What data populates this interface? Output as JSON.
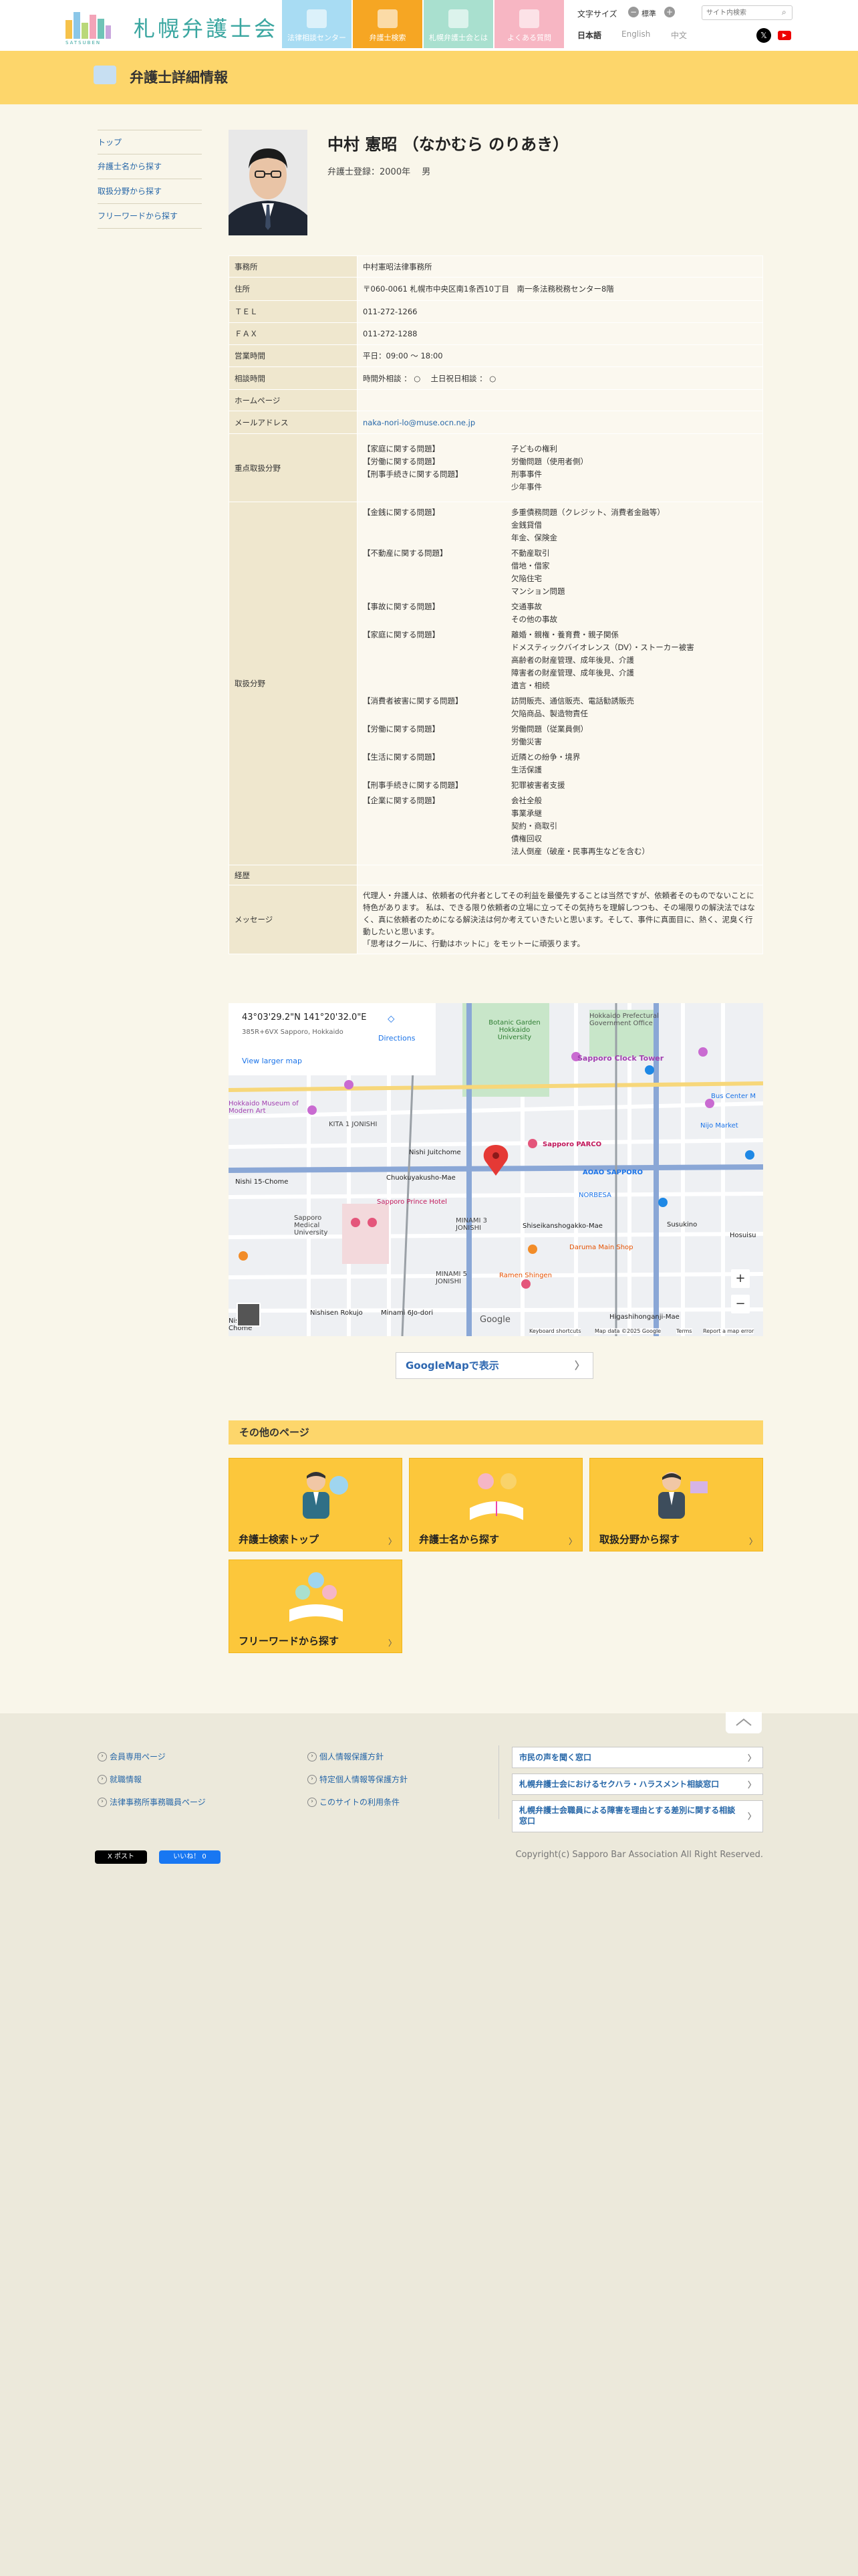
{
  "header": {
    "logo_text": "札幌弁護士会",
    "logo_sub": "SATSUBEN",
    "nav": [
      {
        "label": "法律相談センター",
        "color": "#a8dcf3"
      },
      {
        "label": "弁護士検索",
        "color": "#f6a623"
      },
      {
        "label": "札幌弁護士会とは",
        "color": "#a9e0cf"
      },
      {
        "label": "よくある質問",
        "color": "#f7b6c3"
      }
    ],
    "font_size_label": "文字サイズ",
    "font_size_value": "標準",
    "search_placeholder": "サイト内検索",
    "langs": [
      "日本語",
      "English",
      "中文"
    ]
  },
  "band": {
    "title": "弁護士詳細情報"
  },
  "sidebar": {
    "items": [
      "トップ",
      "弁護士名から探す",
      "取扱分野から探す",
      "フリーワードから探す"
    ]
  },
  "lawyer": {
    "name": "中村 憲昭 （なかむら のりあき）",
    "registration": "弁護士登録：2000年　 男"
  },
  "info": {
    "office_label": "事務所",
    "office": "中村憲昭法律事務所",
    "address_label": "住所",
    "address": "〒060-0061 札幌市中央区南1条西10丁目　南一条法務税務センター8階",
    "tel_label": "ＴＥＬ",
    "tel": "011-272-1266",
    "fax_label": "ＦＡＸ",
    "fax": "011-272-1288",
    "hours_label": "営業時間",
    "hours": "平日：09:00 ～ 18:00",
    "consult_label": "相談時間",
    "consult": "時間外相談 ： ○ 　土日祝日相談 ： ○",
    "homepage_label": "ホームページ",
    "homepage": "",
    "email_label": "メールアドレス",
    "email": "naka-nori-lo@muse.ocn.ne.jp",
    "focus_label": "重点取扱分野",
    "focus": [
      {
        "k": "【家庭に関する問題】",
        "v": [
          "子どもの権利"
        ]
      },
      {
        "k": "【労働に関する問題】",
        "v": [
          "労働問題（使用者側）"
        ]
      },
      {
        "k": "【刑事手続きに関する問題】",
        "v": [
          "刑事事件",
          "少年事件"
        ]
      }
    ],
    "fields_label": "取扱分野",
    "fields": [
      {
        "k": "【金銭に関する問題】",
        "v": [
          "多重債務問題（クレジット、消費者金融等）",
          "金銭貸借",
          "年金、保険金"
        ]
      },
      {
        "k": "【不動産に関する問題】",
        "v": [
          "不動産取引",
          "借地・借家",
          "欠陥住宅",
          "マンション問題"
        ]
      },
      {
        "k": "【事故に関する問題】",
        "v": [
          "交通事故",
          "その他の事故"
        ]
      },
      {
        "k": "【家庭に関する問題】",
        "v": [
          "離婚・親権・養育費・親子関係",
          "ドメスティックバイオレンス（DV）・ストーカー被害",
          "高齢者の財産管理、成年後見、介護",
          "障害者の財産管理、成年後見、介護",
          "遺言・相続"
        ]
      },
      {
        "k": "【消費者被害に関する問題】",
        "v": [
          "訪問販売、通信販売、電話勧誘販売",
          "欠陥商品、製造物責任"
        ]
      },
      {
        "k": "【労働に関する問題】",
        "v": [
          "労働問題（従業員側）",
          "労働災害"
        ]
      },
      {
        "k": "【生活に関する問題】",
        "v": [
          "近隣との紛争・境界",
          "生活保護"
        ]
      },
      {
        "k": "【刑事手続きに関する問題】",
        "v": [
          "犯罪被害者支援"
        ]
      },
      {
        "k": "【企業に関する問題】",
        "v": [
          "会社全般",
          "事業承継",
          "契約・商取引",
          "債権回収",
          "法人倒産（破産・民事再生などを含む）"
        ]
      }
    ],
    "career_label": "経歴",
    "career": "",
    "message_label": "メッセージ",
    "message": "代理人・弁護人は、依頼者の代弁者としてその利益を最優先することは当然ですが、依頼者そのものでないことに特色があります。 私は、できる限り依頼者の立場に立ってその気持ちを理解しつつも、その場限りの解決法ではなく、真に依頼者のためになる解決法は何か考えていきたいと思います。そして、事件に真面目に、熱く、泥臭く行動したいと思います。\n「思考はクールに、行動はホットに」をモットーに頑張ります。"
  },
  "map": {
    "coords": "43°03'29.2\"N 141°20'32.0\"E",
    "plus_code": "385R+6VX Sapporo, Hokkaido",
    "larger": "View larger map",
    "directions": "Directions",
    "labels": [
      "Botanic Garden Hokkaido University",
      "Hokkaido Prefectural Government Office",
      "Sapporo Clock Tower",
      "Hokkaido Museum of Modern Art",
      "KITA 1 JONISHI",
      "Nishi Juitchome",
      "Chuokuyakusho-Mae",
      "Sapporo PARCO",
      "AOAO SAPPORO",
      "NORBESA",
      "Nishi 15-Chome",
      "Sapporo Prince Hotel",
      "Sapporo Medical University",
      "MINAMI 3 JONISHI",
      "Shiseikanshogakko-Mae",
      "Susukino",
      "Ramen Shingen",
      "Daruma Main Shop",
      "MINAMI 5 JONISHI",
      "Nishisen Rokujo",
      "Minami 6Jo-dori",
      "Higashihonganji-Mae",
      "Bus Center M",
      "Nijo Market",
      "Hosuisu",
      "Nishi 11-Chome"
    ],
    "footer": [
      "Keyboard shortcuts",
      "Map data ©2025 Google",
      "Terms",
      "Report a map error"
    ],
    "google": "Google"
  },
  "gmap_button": "GoogleMapで表示",
  "other": {
    "title": "その他のページ",
    "cards": [
      "弁護士検索トップ",
      "弁護士名から探す",
      "取扱分野から探す",
      "フリーワードから探す"
    ]
  },
  "footer": {
    "col1": [
      "会員専用ページ",
      "就職情報",
      "法律事務所事務職員ページ"
    ],
    "col2": [
      "個人情報保護方針",
      "特定個人情報等保護方針",
      "このサイトの利用条件"
    ],
    "boxes": [
      "市民の声を聞く窓口",
      "札幌弁護士会におけるセクハラ・ハラスメント相談窓口",
      "札幌弁護士会職員による障害を理由とする差別に関する相談窓口"
    ],
    "tw": "X ポスト",
    "fb": "いいね！ 0",
    "copyright": "Copyright(c) Sapporo Bar Association All Right Reserved."
  }
}
